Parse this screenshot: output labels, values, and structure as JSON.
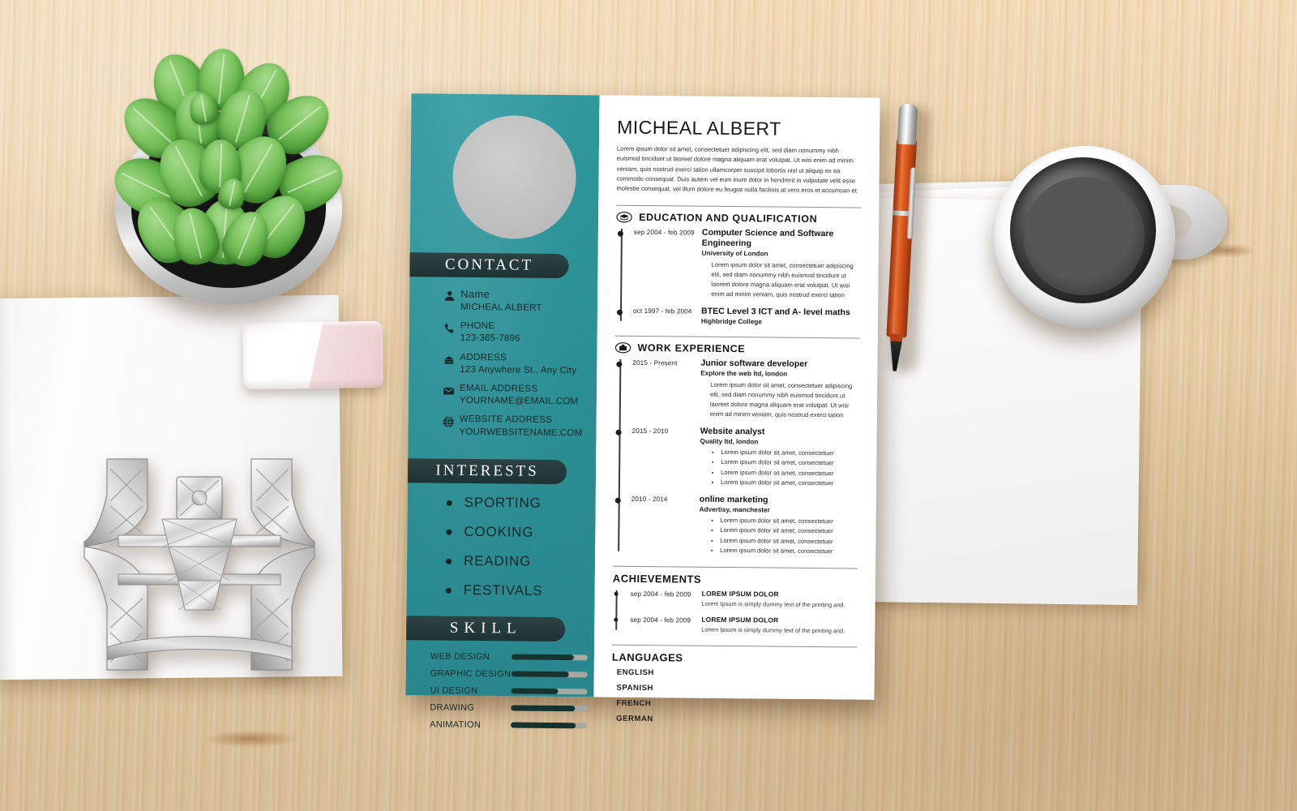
{
  "scene": {
    "desk_color": "#f0d3a8",
    "objects": [
      {
        "name": "potted-basil-plant"
      },
      {
        "name": "notebook"
      },
      {
        "name": "eiffel-tower-figurine"
      },
      {
        "name": "eraser"
      },
      {
        "name": "ballpoint-pen"
      },
      {
        "name": "coffee-mug"
      },
      {
        "name": "paper-stack"
      }
    ]
  },
  "resume": {
    "accent_teal": "#2a9196",
    "accent_dark": "#22383a",
    "header": {
      "name": "MICHEAL ALBERT",
      "summary": "Lorem ipsum dolor sit amet, consectetuer adipiscing elit, sed diam nonummy nibh euismod tincidunt ut laoreet dolore magna aliquam erat volutpat. Ut wisi enim ad minim veniam, quis nostrud exerci tation ullamcorper suscipit lobortis nisl ut aliquip ex ea commodo consequat. Duis autem vel eum iriure dolor in hendrerit in vulputate velit esse molestie consequat, vel illum dolore eu feugiat nulla facilisis at vero eros et accumsan et"
    },
    "sidebar": {
      "contact_heading": "CONTACT",
      "contact": [
        {
          "icon": "person-icon",
          "label": "Name",
          "value": "MICHEAL ALBERT"
        },
        {
          "icon": "phone-icon",
          "label": "PHONE",
          "value": "123-365-7896"
        },
        {
          "icon": "home-icon",
          "label": "ADDRESS",
          "value": "123 Anywhere St., Any City"
        },
        {
          "icon": "envelope-icon",
          "label": "EMAIL ADDRESS",
          "value": "YOURNAME@EMAIL.COM"
        },
        {
          "icon": "globe-icon",
          "label": "WEBSITE ADDRESS",
          "value": "YOURWEBSITENAME.COM"
        }
      ],
      "interests_heading": "INTERESTS",
      "interests": [
        "SPORTING",
        "COOKING",
        "READING",
        "FESTIVALS"
      ],
      "skill_heading": "SKILL",
      "skills": [
        {
          "name": "WEB DESIGN",
          "level": 82
        },
        {
          "name": "GRAPHIC DESIGN",
          "level": 76
        },
        {
          "name": "UI DESIGN",
          "level": 62
        },
        {
          "name": "DRAWING",
          "level": 84
        },
        {
          "name": "ANIMATION",
          "level": 85
        }
      ]
    },
    "education": {
      "icon": "graduation-cap-icon",
      "title": "EDUCATION AND QUALIFICATION",
      "items": [
        {
          "date": "sep 2004 - feb 2009",
          "title": "Computer Science and Software Engineering",
          "sub": "University of London",
          "desc": "Lorem ipsum dolor sit amet, consectetuer adipiscing elit, sed diam nonummy nibh euismod tincidunt ut laoreet dolore magna aliquam erat volutpat. Ut wisi enim ad minim veniam, quis nostrud exerci tation"
        },
        {
          "date": "oct 1997 - feb 2004",
          "title": "BTEC Level 3 ICT and A- level maths",
          "sub": "Highbridge College",
          "desc": ""
        }
      ]
    },
    "work": {
      "icon": "briefcase-icon",
      "title": "WORK EXPERIENCE",
      "items": [
        {
          "date": "2015 - Present",
          "title": "Junior software developer",
          "sub": "Explore the web ltd, london",
          "desc": "Lorem ipsum dolor sit amet, consectetuer adipiscing elit, sed diam nonummy nibh euismod tincidunt ut laoreet dolore magna aliquam erat volutpat. Ut wisi enim ad minim veniam, quis nostrud exerci tation",
          "bullets": []
        },
        {
          "date": "2015 - 2010",
          "title": "Website analyst",
          "sub": "Quality ltd, london",
          "desc": "",
          "bullets": [
            "Lorem ipsum dolor sit amet, consectetuer",
            "Lorem ipsum dolor sit amet, consectetuer",
            "Lorem ipsum dolor sit amet, consectetuer",
            "Lorem ipsum dolor sit amet, consectetuer"
          ]
        },
        {
          "date": "2010 - 2014",
          "title": "online marketing",
          "sub": "Advertisy, manchester",
          "desc": "",
          "bullets": [
            "Lorem ipsum dolor sit amet, consectetuer",
            "Lorem ipsum dolor sit amet, consectetuer",
            "Lorem ipsum dolor sit amet, consectetuer",
            "Lorem ipsum dolor sit amet, consectetuer"
          ]
        }
      ]
    },
    "achievements": {
      "title": "ACHIEVEMENTS",
      "items": [
        {
          "date": "sep 2004 - feb 2009",
          "title": "LOREM IPSUM DOLOR",
          "desc": "Lorem Ipsum is simply dummy text of the printing and."
        },
        {
          "date": "sep 2004 - feb 2009",
          "title": "LOREM IPSUM DOLOR",
          "desc": "Lorem Ipsum is simply dummy text of the printing and."
        }
      ]
    },
    "languages": {
      "title": "LANGUAGES",
      "items": [
        "ENGLISH",
        "SPANISH",
        "FRENCH",
        "GERMAN"
      ]
    }
  }
}
